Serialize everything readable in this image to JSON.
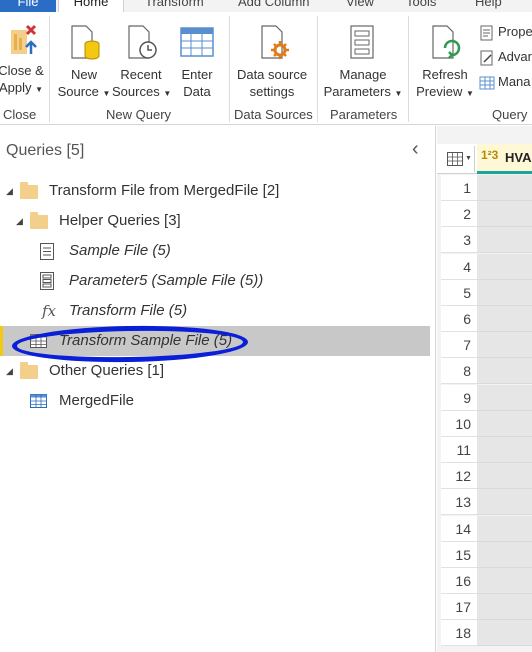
{
  "ribbon": {
    "tabs": [
      "File",
      "Home",
      "Transform",
      "Add Column",
      "View",
      "Tools",
      "Help"
    ],
    "close_apply": {
      "line1": "Close &",
      "line2": "Apply"
    },
    "new_source": {
      "line1": "New",
      "line2": "Source"
    },
    "recent_sources": {
      "line1": "Recent",
      "line2": "Sources"
    },
    "enter_data": {
      "line1": "Enter",
      "line2": "Data"
    },
    "data_source_settings": {
      "line1": "Data source",
      "line2": "settings"
    },
    "manage_parameters": {
      "line1": "Manage",
      "line2": "Parameters"
    },
    "refresh_preview": {
      "line1": "Refresh",
      "line2": "Preview"
    },
    "properties": "Prope",
    "advanced_editor": "Advar",
    "manage": "Mana",
    "groups": {
      "close": "Close",
      "new_query": "New Query",
      "data_sources": "Data Sources",
      "parameters": "Parameters",
      "query": "Query"
    }
  },
  "queries": {
    "title": "Queries [5]",
    "collapse": "‹",
    "items": [
      {
        "label": "Transform File from MergedFile [2]",
        "icon": "folder-icon"
      },
      {
        "label": "Helper Queries [3]",
        "icon": "folder-icon"
      },
      {
        "label": "Sample File (5)",
        "icon": "document-icon"
      },
      {
        "label": "Parameter5 (Sample File (5))",
        "icon": "parameter-icon"
      },
      {
        "label": "Transform File (5)",
        "icon": "function-icon",
        "glyph": "fx"
      },
      {
        "label": "Transform Sample File (5)",
        "icon": "table-icon"
      },
      {
        "label": "Other Queries [1]",
        "icon": "folder-icon"
      },
      {
        "label": "MergedFile",
        "icon": "table-icon"
      }
    ]
  },
  "grid": {
    "column_type": "1²3",
    "column_name": "HVA",
    "row_numbers": [
      "1",
      "2",
      "3",
      "4",
      "5",
      "6",
      "7",
      "8",
      "9",
      "10",
      "11",
      "12",
      "13",
      "14",
      "15",
      "16",
      "17",
      "18"
    ]
  },
  "colors": {
    "accent_yellow": "#f2c811",
    "highlight_blue": "#0a1fd8",
    "file_tab_blue": "#2b6cc4",
    "column_underline": "#1aa59b"
  }
}
